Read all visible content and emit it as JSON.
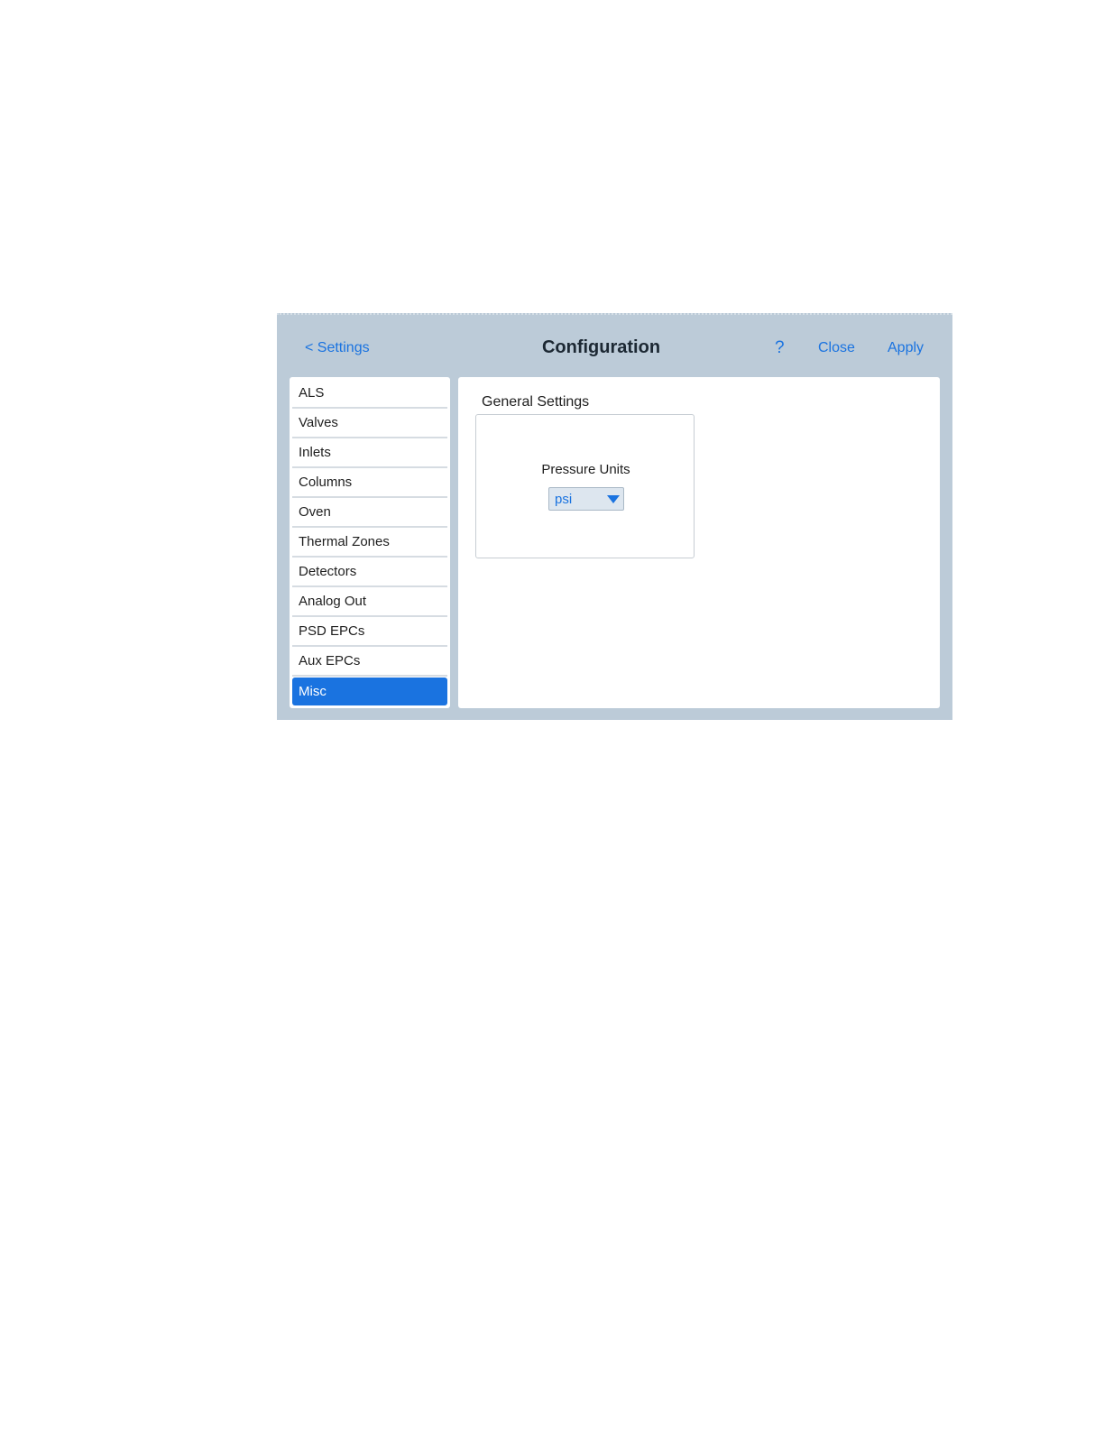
{
  "header": {
    "back_label": "< Settings",
    "title": "Configuration",
    "help_label": "?",
    "close_label": "Close",
    "apply_label": "Apply"
  },
  "sidebar": {
    "items": [
      {
        "label": "ALS"
      },
      {
        "label": "Valves"
      },
      {
        "label": "Inlets"
      },
      {
        "label": "Columns"
      },
      {
        "label": "Oven"
      },
      {
        "label": "Thermal Zones"
      },
      {
        "label": "Detectors"
      },
      {
        "label": "Analog Out"
      },
      {
        "label": "PSD EPCs"
      },
      {
        "label": "Aux EPCs"
      },
      {
        "label": "Misc"
      }
    ],
    "selected": "Misc"
  },
  "main": {
    "section_label": "General Settings",
    "pressure_units": {
      "label": "Pressure Units",
      "value": "psi"
    }
  },
  "colors": {
    "accent": "#1a73e0",
    "panel_background": "#bccbd8"
  }
}
